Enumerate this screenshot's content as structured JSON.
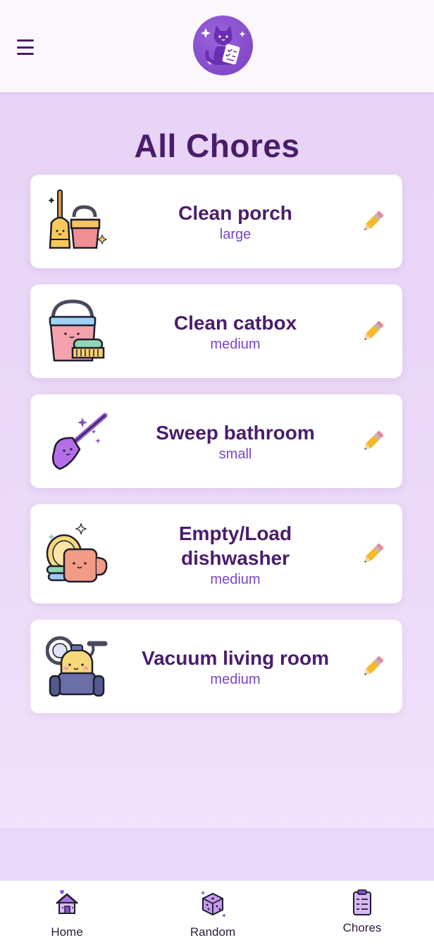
{
  "header": {
    "menu_icon": "hamburger-menu-icon",
    "logo_icon": "cat-with-checklist-logo"
  },
  "page": {
    "title": "All Chores"
  },
  "chores": [
    {
      "name": "Clean porch",
      "size": "large",
      "icon": "broom-and-bucket-icon",
      "edit_icon": "pencil-icon"
    },
    {
      "name": "Clean catbox",
      "size": "medium",
      "icon": "bucket-and-brush-icon",
      "edit_icon": "pencil-icon"
    },
    {
      "name": "Sweep bathroom",
      "size": "small",
      "icon": "purple-broom-icon",
      "edit_icon": "pencil-icon"
    },
    {
      "name": "Empty/Load dishwasher",
      "size": "medium",
      "icon": "plates-and-mug-icon",
      "edit_icon": "pencil-icon"
    },
    {
      "name": "Vacuum living room",
      "size": "medium",
      "icon": "vacuum-cleaner-icon",
      "edit_icon": "pencil-icon"
    }
  ],
  "nav": {
    "items": [
      {
        "label": "Home",
        "icon": "house-icon"
      },
      {
        "label": "Random",
        "icon": "dice-icon"
      },
      {
        "label": "Chores",
        "icon": "clipboard-icon"
      }
    ]
  },
  "colors": {
    "primary_text": "#4a1d6b",
    "size_text": "#7a45c4",
    "background": "#e8d3f6",
    "card": "#ffffff"
  }
}
